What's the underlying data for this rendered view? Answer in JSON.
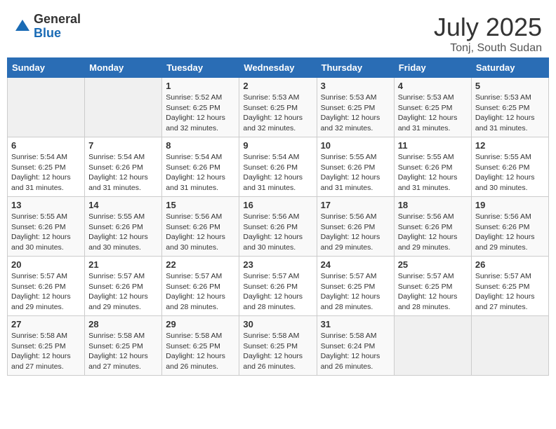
{
  "logo": {
    "general": "General",
    "blue": "Blue"
  },
  "title": "July 2025",
  "subtitle": "Tonj, South Sudan",
  "days_of_week": [
    "Sunday",
    "Monday",
    "Tuesday",
    "Wednesday",
    "Thursday",
    "Friday",
    "Saturday"
  ],
  "weeks": [
    [
      {
        "day": "",
        "info": ""
      },
      {
        "day": "",
        "info": ""
      },
      {
        "day": "1",
        "info": "Sunrise: 5:52 AM\nSunset: 6:25 PM\nDaylight: 12 hours\nand 32 minutes."
      },
      {
        "day": "2",
        "info": "Sunrise: 5:53 AM\nSunset: 6:25 PM\nDaylight: 12 hours\nand 32 minutes."
      },
      {
        "day": "3",
        "info": "Sunrise: 5:53 AM\nSunset: 6:25 PM\nDaylight: 12 hours\nand 32 minutes."
      },
      {
        "day": "4",
        "info": "Sunrise: 5:53 AM\nSunset: 6:25 PM\nDaylight: 12 hours\nand 31 minutes."
      },
      {
        "day": "5",
        "info": "Sunrise: 5:53 AM\nSunset: 6:25 PM\nDaylight: 12 hours\nand 31 minutes."
      }
    ],
    [
      {
        "day": "6",
        "info": "Sunrise: 5:54 AM\nSunset: 6:25 PM\nDaylight: 12 hours\nand 31 minutes."
      },
      {
        "day": "7",
        "info": "Sunrise: 5:54 AM\nSunset: 6:26 PM\nDaylight: 12 hours\nand 31 minutes."
      },
      {
        "day": "8",
        "info": "Sunrise: 5:54 AM\nSunset: 6:26 PM\nDaylight: 12 hours\nand 31 minutes."
      },
      {
        "day": "9",
        "info": "Sunrise: 5:54 AM\nSunset: 6:26 PM\nDaylight: 12 hours\nand 31 minutes."
      },
      {
        "day": "10",
        "info": "Sunrise: 5:55 AM\nSunset: 6:26 PM\nDaylight: 12 hours\nand 31 minutes."
      },
      {
        "day": "11",
        "info": "Sunrise: 5:55 AM\nSunset: 6:26 PM\nDaylight: 12 hours\nand 31 minutes."
      },
      {
        "day": "12",
        "info": "Sunrise: 5:55 AM\nSunset: 6:26 PM\nDaylight: 12 hours\nand 30 minutes."
      }
    ],
    [
      {
        "day": "13",
        "info": "Sunrise: 5:55 AM\nSunset: 6:26 PM\nDaylight: 12 hours\nand 30 minutes."
      },
      {
        "day": "14",
        "info": "Sunrise: 5:55 AM\nSunset: 6:26 PM\nDaylight: 12 hours\nand 30 minutes."
      },
      {
        "day": "15",
        "info": "Sunrise: 5:56 AM\nSunset: 6:26 PM\nDaylight: 12 hours\nand 30 minutes."
      },
      {
        "day": "16",
        "info": "Sunrise: 5:56 AM\nSunset: 6:26 PM\nDaylight: 12 hours\nand 30 minutes."
      },
      {
        "day": "17",
        "info": "Sunrise: 5:56 AM\nSunset: 6:26 PM\nDaylight: 12 hours\nand 29 minutes."
      },
      {
        "day": "18",
        "info": "Sunrise: 5:56 AM\nSunset: 6:26 PM\nDaylight: 12 hours\nand 29 minutes."
      },
      {
        "day": "19",
        "info": "Sunrise: 5:56 AM\nSunset: 6:26 PM\nDaylight: 12 hours\nand 29 minutes."
      }
    ],
    [
      {
        "day": "20",
        "info": "Sunrise: 5:57 AM\nSunset: 6:26 PM\nDaylight: 12 hours\nand 29 minutes."
      },
      {
        "day": "21",
        "info": "Sunrise: 5:57 AM\nSunset: 6:26 PM\nDaylight: 12 hours\nand 29 minutes."
      },
      {
        "day": "22",
        "info": "Sunrise: 5:57 AM\nSunset: 6:26 PM\nDaylight: 12 hours\nand 28 minutes."
      },
      {
        "day": "23",
        "info": "Sunrise: 5:57 AM\nSunset: 6:26 PM\nDaylight: 12 hours\nand 28 minutes."
      },
      {
        "day": "24",
        "info": "Sunrise: 5:57 AM\nSunset: 6:25 PM\nDaylight: 12 hours\nand 28 minutes."
      },
      {
        "day": "25",
        "info": "Sunrise: 5:57 AM\nSunset: 6:25 PM\nDaylight: 12 hours\nand 28 minutes."
      },
      {
        "day": "26",
        "info": "Sunrise: 5:57 AM\nSunset: 6:25 PM\nDaylight: 12 hours\nand 27 minutes."
      }
    ],
    [
      {
        "day": "27",
        "info": "Sunrise: 5:58 AM\nSunset: 6:25 PM\nDaylight: 12 hours\nand 27 minutes."
      },
      {
        "day": "28",
        "info": "Sunrise: 5:58 AM\nSunset: 6:25 PM\nDaylight: 12 hours\nand 27 minutes."
      },
      {
        "day": "29",
        "info": "Sunrise: 5:58 AM\nSunset: 6:25 PM\nDaylight: 12 hours\nand 26 minutes."
      },
      {
        "day": "30",
        "info": "Sunrise: 5:58 AM\nSunset: 6:25 PM\nDaylight: 12 hours\nand 26 minutes."
      },
      {
        "day": "31",
        "info": "Sunrise: 5:58 AM\nSunset: 6:24 PM\nDaylight: 12 hours\nand 26 minutes."
      },
      {
        "day": "",
        "info": ""
      },
      {
        "day": "",
        "info": ""
      }
    ]
  ]
}
